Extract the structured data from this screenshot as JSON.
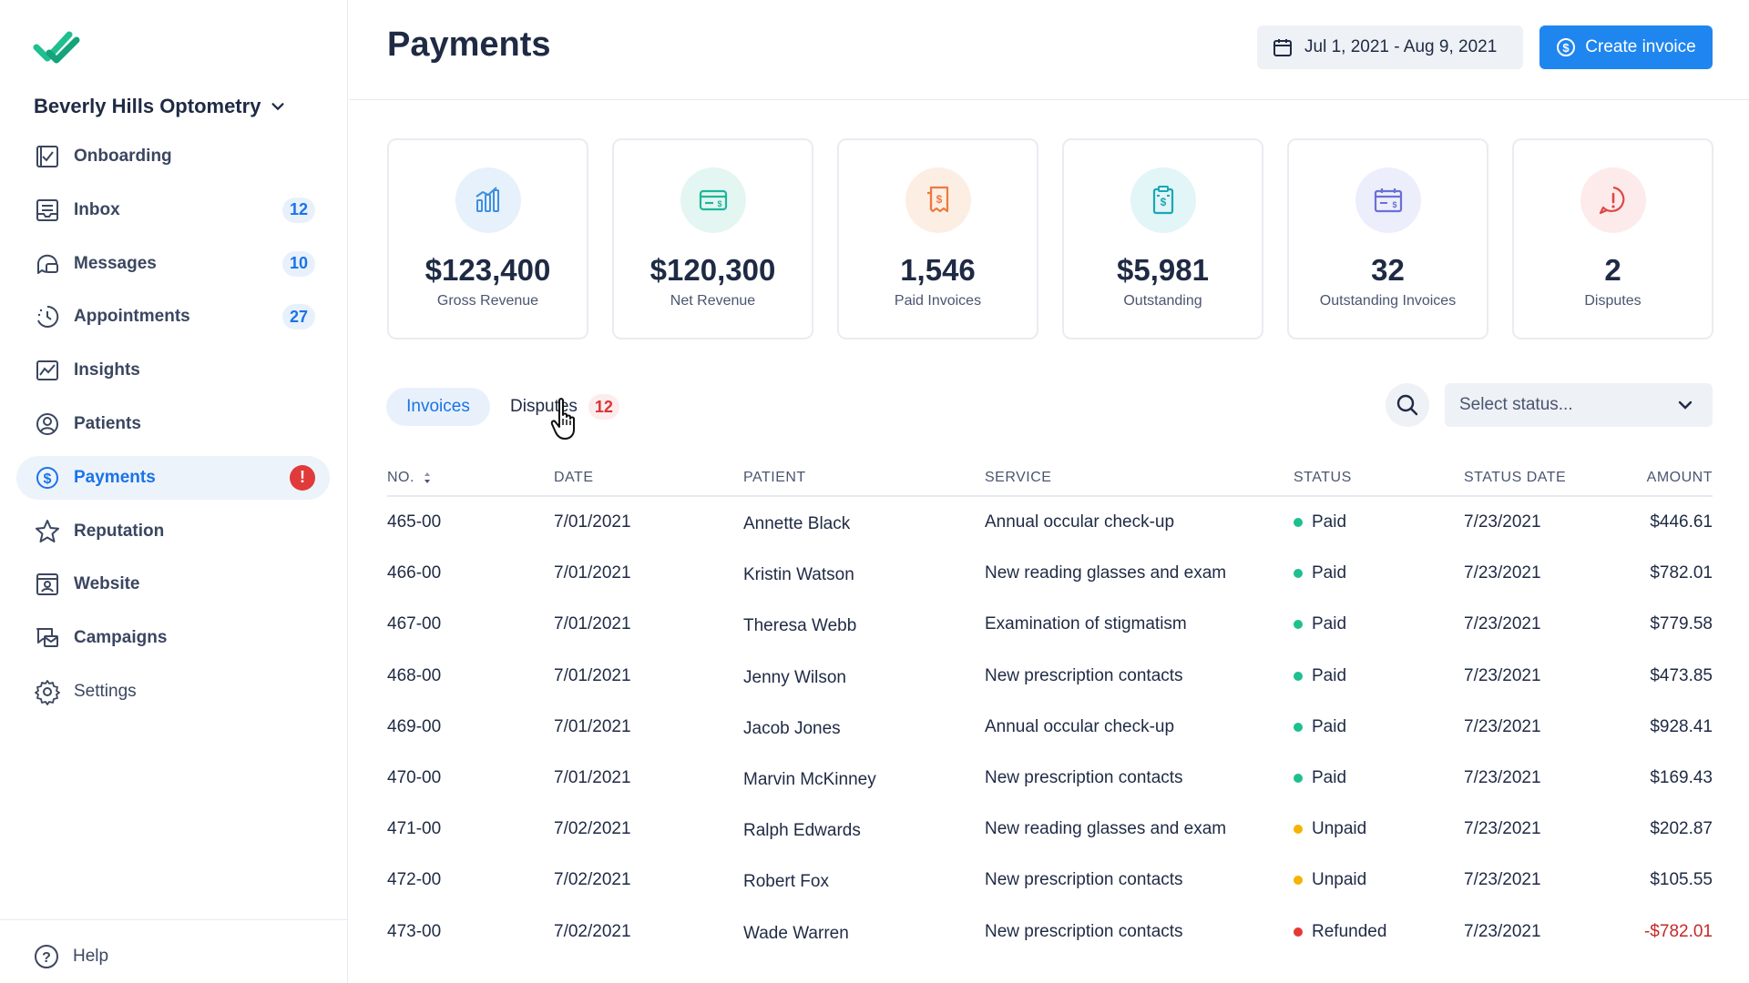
{
  "sidebar": {
    "org_name": "Beverly Hills Optometry",
    "items": [
      {
        "label": "Onboarding",
        "icon": "onboarding-icon",
        "badge": ""
      },
      {
        "label": "Inbox",
        "icon": "inbox-icon",
        "badge": "12"
      },
      {
        "label": "Messages",
        "icon": "messages-icon",
        "badge": "10"
      },
      {
        "label": "Appointments",
        "icon": "appointments-icon",
        "badge": "27"
      },
      {
        "label": "Insights",
        "icon": "insights-icon",
        "badge": ""
      },
      {
        "label": "Patients",
        "icon": "patients-icon",
        "badge": ""
      },
      {
        "label": "Payments",
        "icon": "dollar-icon",
        "badge": "!"
      },
      {
        "label": "Reputation",
        "icon": "star-icon",
        "badge": ""
      },
      {
        "label": "Website",
        "icon": "website-icon",
        "badge": ""
      },
      {
        "label": "Campaigns",
        "icon": "campaigns-icon",
        "badge": ""
      },
      {
        "label": "Settings",
        "icon": "gear-icon",
        "badge": ""
      }
    ],
    "help_label": "Help"
  },
  "header": {
    "title": "Payments",
    "date_range": "Jul 1, 2021 - Aug 9, 2021",
    "create_label": "Create invoice"
  },
  "stats": [
    {
      "value": "$123,400",
      "label": "Gross Revenue",
      "icon": "bar-chart-icon",
      "color": "#3d8fe0",
      "bg": "#e6f1fc"
    },
    {
      "value": "$120,300",
      "label": "Net Revenue",
      "icon": "payment-card-icon",
      "color": "#1fb59a",
      "bg": "#e3f6f1"
    },
    {
      "value": "1,546",
      "label": "Paid Invoices",
      "icon": "invoice-icon",
      "color": "#ec7a3c",
      "bg": "#fdeee4"
    },
    {
      "value": "$5,981",
      "label": "Outstanding",
      "icon": "clipboard-dollar-icon",
      "color": "#1aa7b8",
      "bg": "#e2f5f7"
    },
    {
      "value": "32",
      "label": "Outstanding Invoices",
      "icon": "calendar-card-icon",
      "color": "#6b6fd6",
      "bg": "#eceefb"
    },
    {
      "value": "2",
      "label": "Disputes",
      "icon": "alert-circle-icon",
      "color": "#e04646",
      "bg": "#fdebeb"
    }
  ],
  "tabs": {
    "invoices": "Invoices",
    "disputes": "Disputes",
    "disputes_count": "12"
  },
  "filter": {
    "status_placeholder": "Select status..."
  },
  "table": {
    "headers": {
      "no": "NO.",
      "date": "DATE",
      "patient": "PATIENT",
      "service": "SERVICE",
      "status": "STATUS",
      "status_date": "STATUS DATE",
      "amount": "AMOUNT"
    },
    "status_colors": {
      "Paid": "#1fbf8f",
      "Unpaid": "#f4b400",
      "Refunded": "#e53935"
    },
    "rows": [
      {
        "no": "465-00",
        "date": "7/01/2021",
        "patient": "Annette Black",
        "service": "Annual occular check-up",
        "status": "Paid",
        "status_date": "7/23/2021",
        "amount": "$446.61"
      },
      {
        "no": "466-00",
        "date": "7/01/2021",
        "patient": "Kristin Watson",
        "service": "New reading glasses and exam",
        "status": "Paid",
        "status_date": "7/23/2021",
        "amount": "$782.01"
      },
      {
        "no": "467-00",
        "date": "7/01/2021",
        "patient": "Theresa Webb",
        "service": "Examination of stigmatism",
        "status": "Paid",
        "status_date": "7/23/2021",
        "amount": "$779.58"
      },
      {
        "no": "468-00",
        "date": "7/01/2021",
        "patient": "Jenny Wilson",
        "service": "New prescription contacts",
        "status": "Paid",
        "status_date": "7/23/2021",
        "amount": "$473.85"
      },
      {
        "no": "469-00",
        "date": "7/01/2021",
        "patient": "Jacob Jones",
        "service": "Annual occular check-up",
        "status": "Paid",
        "status_date": "7/23/2021",
        "amount": "$928.41"
      },
      {
        "no": "470-00",
        "date": "7/01/2021",
        "patient": "Marvin McKinney",
        "service": "New prescription contacts",
        "status": "Paid",
        "status_date": "7/23/2021",
        "amount": "$169.43"
      },
      {
        "no": "471-00",
        "date": "7/02/2021",
        "patient": "Ralph Edwards",
        "service": "New reading glasses and exam",
        "status": "Unpaid",
        "status_date": "7/23/2021",
        "amount": "$202.87"
      },
      {
        "no": "472-00",
        "date": "7/02/2021",
        "patient": "Robert Fox",
        "service": "New prescription contacts",
        "status": "Unpaid",
        "status_date": "7/23/2021",
        "amount": "$105.55"
      },
      {
        "no": "473-00",
        "date": "7/02/2021",
        "patient": "Wade Warren",
        "service": "New prescription contacts",
        "status": "Refunded",
        "status_date": "7/23/2021",
        "amount": "-$782.01"
      }
    ]
  }
}
